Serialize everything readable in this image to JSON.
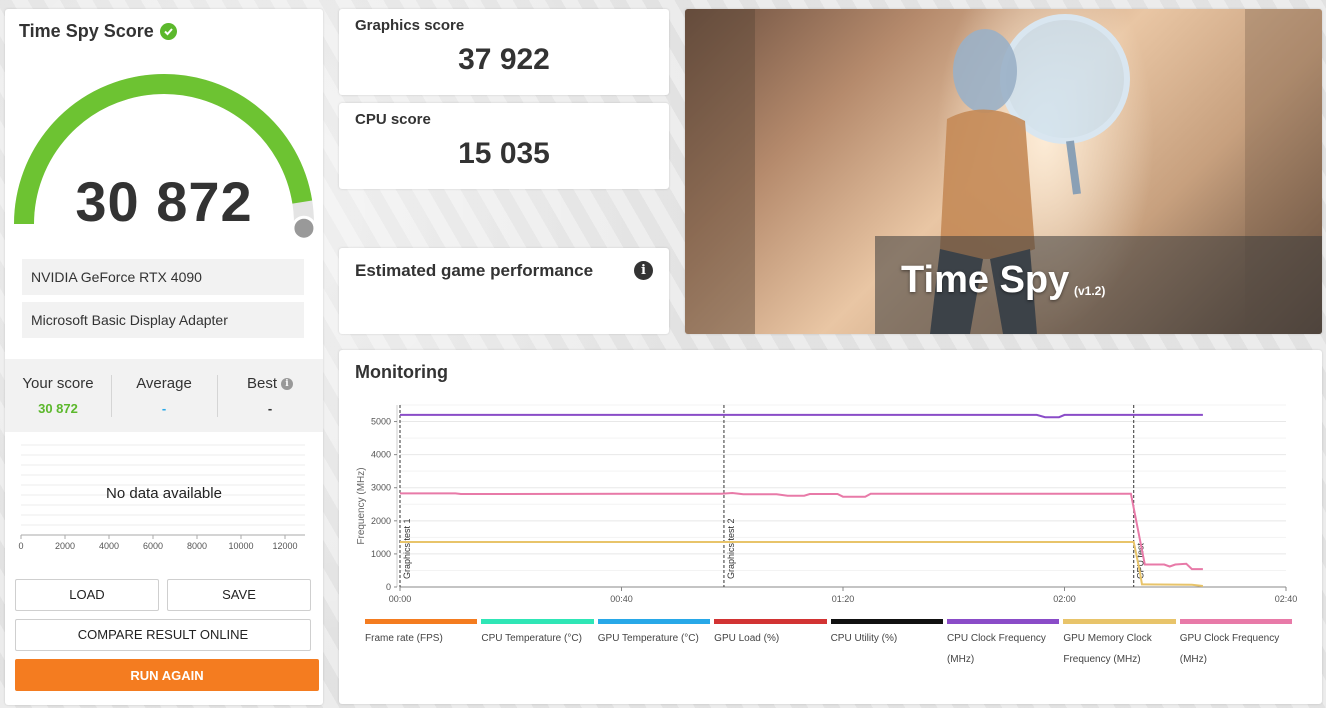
{
  "score_panel": {
    "title": "Time Spy Score",
    "score": "30 872",
    "gauge_fraction": 0.95,
    "devices": [
      "NVIDIA GeForce RTX 4090",
      "Microsoft Basic Display Adapter"
    ],
    "your_score_label": "Your score",
    "your_score_value": "30 872",
    "average_label": "Average",
    "average_value": "-",
    "best_label": "Best",
    "best_value": "-",
    "no_data": "No data available",
    "x_ticks": [
      "0",
      "2000",
      "4000",
      "6000",
      "8000",
      "10000",
      "12000"
    ],
    "buttons": {
      "load": "LOAD",
      "save": "SAVE",
      "compare": "COMPARE RESULT ONLINE",
      "run_again": "RUN AGAIN"
    }
  },
  "graphics_score": {
    "label": "Graphics score",
    "value": "37 922"
  },
  "cpu_score": {
    "label": "CPU score",
    "value": "15 035"
  },
  "estimated": {
    "title": "Estimated game performance"
  },
  "hero": {
    "title": "Time Spy",
    "version": "(v1.2)"
  },
  "monitoring": {
    "title": "Monitoring",
    "legend": [
      {
        "label": "Frame rate (FPS)",
        "color": "#f47c20"
      },
      {
        "label": "CPU Temperature (°C)",
        "color": "#2fe6b6"
      },
      {
        "label": "GPU Temperature (°C)",
        "color": "#28a8e8"
      },
      {
        "label": "GPU Load (%)",
        "color": "#d23333"
      },
      {
        "label": "CPU Utility (%)",
        "color": "#111111"
      },
      {
        "label": "CPU Clock Frequency (MHz)",
        "color": "#8a4cc8"
      },
      {
        "label": "GPU Memory Clock Frequency (MHz)",
        "color": "#e8c46a"
      },
      {
        "label": "GPU Clock Frequency (MHz)",
        "color": "#e87aa8"
      }
    ]
  },
  "chart_data": {
    "type": "line",
    "ylabel": "Frequency (MHz)",
    "ylim": [
      0,
      5500
    ],
    "xlim": [
      0,
      160
    ],
    "y_ticks": [
      "0",
      "1000",
      "2000",
      "3000",
      "4000",
      "5000"
    ],
    "x_ticks": [
      "00:00",
      "00:40",
      "01:20",
      "02:00",
      "02:40"
    ],
    "x_tick_values": [
      0,
      40,
      80,
      120,
      160
    ],
    "markers": [
      {
        "label": "Graphics test 1",
        "x": 0
      },
      {
        "label": "Graphics test 2",
        "x": 58.5
      },
      {
        "label": "CPU test",
        "x": 132.5
      }
    ],
    "series": [
      {
        "name": "CPU Clock Frequency (MHz)",
        "color": "#8a4cc8",
        "points": [
          [
            0,
            5200
          ],
          [
            58,
            5200
          ],
          [
            115,
            5200
          ],
          [
            116.5,
            5130
          ],
          [
            119,
            5130
          ],
          [
            120,
            5200
          ],
          [
            132,
            5200
          ],
          [
            145,
            5200
          ]
        ]
      },
      {
        "name": "GPU Memory Clock Frequency (MHz)",
        "color": "#e8c46a",
        "points": [
          [
            0,
            1360
          ],
          [
            132.5,
            1360
          ],
          [
            133.5,
            550
          ],
          [
            134,
            80
          ],
          [
            143,
            70
          ],
          [
            145,
            30
          ]
        ]
      },
      {
        "name": "GPU Clock Frequency (MHz)",
        "color": "#e87aa8",
        "points": [
          [
            0,
            2830
          ],
          [
            10,
            2830
          ],
          [
            11,
            2810
          ],
          [
            58,
            2820
          ],
          [
            60,
            2840
          ],
          [
            62,
            2800
          ],
          [
            68,
            2800
          ],
          [
            70,
            2760
          ],
          [
            73,
            2760
          ],
          [
            74,
            2810
          ],
          [
            79,
            2810
          ],
          [
            80,
            2730
          ],
          [
            84,
            2730
          ],
          [
            85,
            2820
          ],
          [
            132,
            2820
          ],
          [
            134.5,
            680
          ],
          [
            138,
            680
          ],
          [
            139,
            620
          ],
          [
            140,
            680
          ],
          [
            142,
            700
          ],
          [
            143,
            540
          ],
          [
            145,
            540
          ]
        ]
      }
    ]
  }
}
